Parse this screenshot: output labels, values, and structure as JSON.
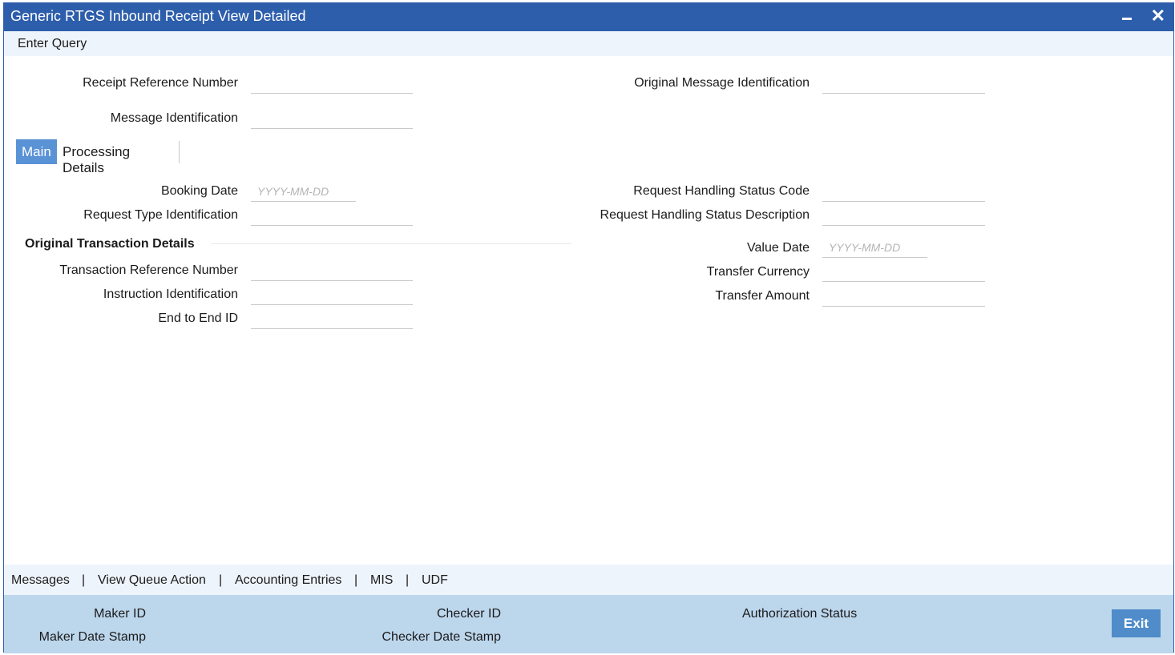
{
  "window": {
    "title": "Generic RTGS Inbound Receipt View Detailed",
    "close_glyph": "✕"
  },
  "toolbar": {
    "enter_query": "Enter Query"
  },
  "header_fields": {
    "receipt_reference_number": {
      "label": "Receipt Reference Number",
      "value": ""
    },
    "original_message_identification": {
      "label": "Original Message Identification",
      "value": ""
    },
    "message_identification": {
      "label": "Message Identification",
      "value": ""
    }
  },
  "tabs": [
    {
      "label": "Main",
      "active": true
    },
    {
      "label": "Processing Details",
      "active": false
    }
  ],
  "main": {
    "booking_date": {
      "label": "Booking Date",
      "placeholder": "YYYY-MM-DD"
    },
    "request_type_identification": {
      "label": "Request Type Identification",
      "value": ""
    },
    "request_handling_status_code": {
      "label": "Request Handling Status Code",
      "value": ""
    },
    "request_handling_status_description": {
      "label": "Request Handling Status Description",
      "value": ""
    },
    "section_title": "Original Transaction Details",
    "transaction_reference_number": {
      "label": "Transaction Reference Number",
      "value": ""
    },
    "instruction_identification": {
      "label": "Instruction Identification",
      "value": ""
    },
    "end_to_end_id": {
      "label": "End to End ID",
      "value": ""
    },
    "value_date": {
      "label": "Value Date",
      "placeholder": "YYYY-MM-DD"
    },
    "transfer_currency": {
      "label": "Transfer Currency",
      "value": ""
    },
    "transfer_amount": {
      "label": "Transfer Amount",
      "value": ""
    }
  },
  "footer_links": [
    "Messages",
    "View Queue Action",
    "Accounting Entries",
    "MIS",
    "UDF"
  ],
  "footer_separator": "|",
  "audit": {
    "maker_id": "Maker ID",
    "maker_date_stamp": "Maker Date Stamp",
    "checker_id": "Checker ID",
    "checker_date_stamp": "Checker Date Stamp",
    "authorization_status": "Authorization Status",
    "exit_label": "Exit"
  },
  "colors": {
    "titlebar": "#2d5eab",
    "active_tab": "#5a92d6",
    "audit_bar": "#bcd6ec",
    "exit_button": "#4f8cc9"
  }
}
